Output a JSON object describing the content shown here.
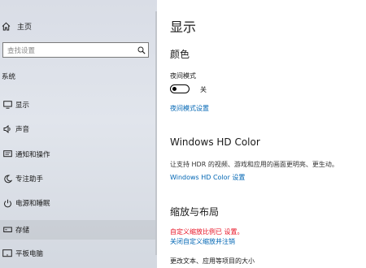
{
  "sidebar": {
    "home_label": "主页",
    "search_placeholder": "查找设置",
    "section_label": "系统",
    "items": [
      {
        "label": "显示",
        "icon": "monitor-icon"
      },
      {
        "label": "声音",
        "icon": "speaker-icon"
      },
      {
        "label": "通知和操作",
        "icon": "notification-icon"
      },
      {
        "label": "专注助手",
        "icon": "moon-icon"
      },
      {
        "label": "电源和睡眠",
        "icon": "power-icon"
      },
      {
        "label": "存储",
        "icon": "storage-icon"
      },
      {
        "label": "平板电脑",
        "icon": "tablet-icon"
      }
    ]
  },
  "main": {
    "title": "显示",
    "color_heading": "颜色",
    "night_light_label": "夜间模式",
    "night_light_state": "关",
    "night_light_on": false,
    "night_light_settings_link": "夜间模式设置",
    "hdr_heading": "Windows HD Color",
    "hdr_description": "让支持 HDR 的视频、游戏和应用的画面更明亮、更生动。",
    "hdr_link": "Windows HD Color 设置",
    "scale_heading": "缩放与布局",
    "custom_scale_warning": "自定义缩放比例已 设置。",
    "custom_scale_link": "关闭自定义缩放并注销",
    "text_size_label": "更改文本、应用等项目的大小"
  },
  "colors": {
    "accent": "#0066b4",
    "warning": "#e81123"
  }
}
